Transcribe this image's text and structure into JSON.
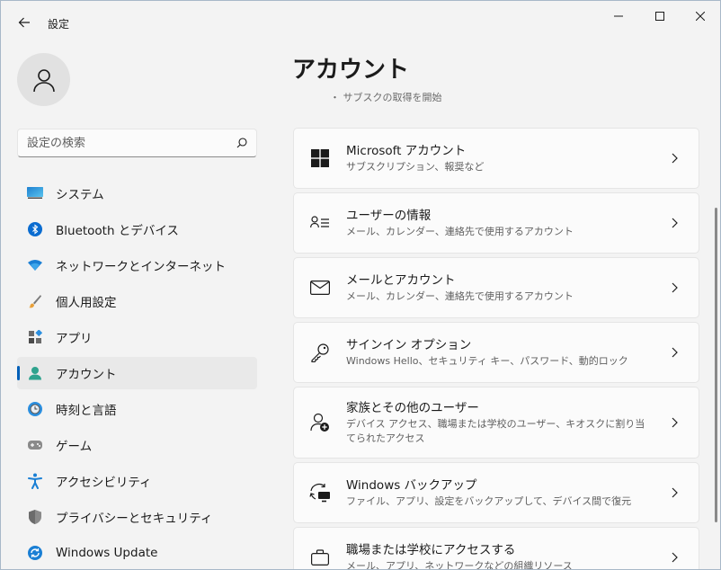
{
  "window": {
    "title": "設定"
  },
  "sidebar": {
    "search_placeholder": "設定の検索",
    "items": [
      {
        "label": "システム",
        "icon": "system-icon"
      },
      {
        "label": "Bluetooth とデバイス",
        "icon": "bluetooth-icon"
      },
      {
        "label": "ネットワークとインターネット",
        "icon": "network-icon"
      },
      {
        "label": "個人用設定",
        "icon": "brush-icon"
      },
      {
        "label": "アプリ",
        "icon": "apps-icon"
      },
      {
        "label": "アカウント",
        "icon": "account-icon",
        "active": true
      },
      {
        "label": "時刻と言語",
        "icon": "time-language-icon"
      },
      {
        "label": "ゲーム",
        "icon": "gamepad-icon"
      },
      {
        "label": "アクセシビリティ",
        "icon": "accessibility-icon"
      },
      {
        "label": "プライバシーとセキュリティ",
        "icon": "shield-icon"
      },
      {
        "label": "Windows Update",
        "icon": "update-icon"
      }
    ]
  },
  "main": {
    "title": "アカウント",
    "clipped_line": "・ サブスクの取得を開始",
    "cards": [
      {
        "title": "Microsoft アカウント",
        "desc": "サブスクリプション、報奨など",
        "icon": "windows-logo-icon"
      },
      {
        "title": "ユーザーの情報",
        "desc": "メール、カレンダー、連絡先で使用するアカウント",
        "icon": "user-info-icon"
      },
      {
        "title": "メールとアカウント",
        "desc": "メール、カレンダー、連絡先で使用するアカウント",
        "icon": "mail-icon"
      },
      {
        "title": "サインイン オプション",
        "desc": "Windows Hello、セキュリティ キー、パスワード、動的ロック",
        "icon": "key-icon"
      },
      {
        "title": "家族とその他のユーザー",
        "desc": "デバイス アクセス、職場または学校のユーザー、キオスクに割り当てられたアクセス",
        "icon": "family-icon"
      },
      {
        "title": "Windows バックアップ",
        "desc": "ファイル、アプリ、設定をバックアップして、デバイス間で復元",
        "icon": "backup-icon"
      },
      {
        "title": "職場または学校にアクセスする",
        "desc": "メール、アプリ、ネットワークなどの組織リソース",
        "icon": "briefcase-icon"
      }
    ]
  },
  "colors": {
    "accent": "#005fb8",
    "background": "#f3f3f3",
    "card": "#fbfbfb"
  }
}
